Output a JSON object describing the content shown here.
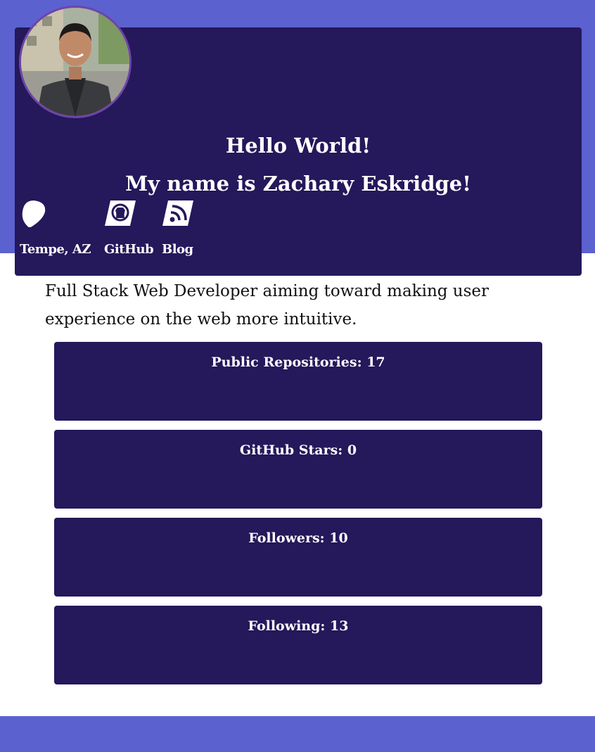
{
  "header": {
    "greeting": "Hello World!",
    "name_line": "My name is Zachary Eskridge!",
    "avatar_icon": "profile-photo"
  },
  "links": [
    {
      "label": "Tempe, AZ",
      "icon": "location-pin-icon"
    },
    {
      "label": "GitHub",
      "icon": "github-icon"
    },
    {
      "label": "Blog",
      "icon": "rss-icon"
    }
  ],
  "bio": "Full Stack Web Developer aiming toward making user experience on the web more intuitive.",
  "stats": [
    {
      "text": "Public Repositories: 17"
    },
    {
      "text": "GitHub Stars: 0"
    },
    {
      "text": "Followers: 10"
    },
    {
      "text": "Following: 13"
    }
  ],
  "colors": {
    "band": "#5c61d0",
    "card": "#25185b",
    "avatar_border": "#6e44a8",
    "text_light": "#ffffff",
    "text_dark": "#111111"
  }
}
